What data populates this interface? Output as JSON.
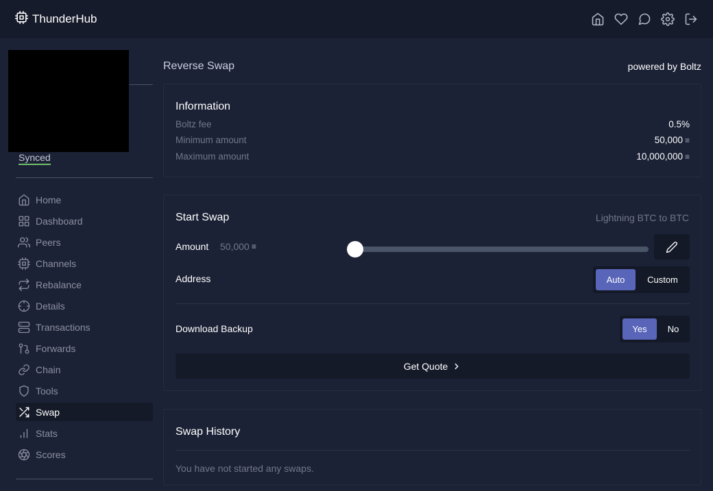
{
  "app": {
    "name": "ThunderHub"
  },
  "top_icons": [
    "home-icon",
    "heart-icon",
    "chat-icon",
    "settings-icon",
    "logout-icon"
  ],
  "sidebar": {
    "status": "Synced",
    "items": [
      {
        "label": "Home",
        "icon": "home-icon"
      },
      {
        "label": "Dashboard",
        "icon": "dashboard-icon"
      },
      {
        "label": "Peers",
        "icon": "users-icon"
      },
      {
        "label": "Channels",
        "icon": "cpu-icon"
      },
      {
        "label": "Rebalance",
        "icon": "repeat-icon"
      },
      {
        "label": "Details",
        "icon": "crosshair-icon"
      },
      {
        "label": "Transactions",
        "icon": "server-icon"
      },
      {
        "label": "Forwards",
        "icon": "git-pull-request-icon"
      },
      {
        "label": "Chain",
        "icon": "link-icon"
      },
      {
        "label": "Tools",
        "icon": "shield-icon"
      },
      {
        "label": "Swap",
        "icon": "shuffle-icon",
        "active": true
      },
      {
        "label": "Stats",
        "icon": "bar-chart-icon"
      },
      {
        "label": "Scores",
        "icon": "aperture-icon"
      }
    ]
  },
  "page": {
    "title": "Reverse Swap",
    "powered_by": "powered by Boltz"
  },
  "info": {
    "title": "Information",
    "rows": [
      {
        "label": "Boltz fee",
        "value": "0.5%",
        "unit": ""
      },
      {
        "label": "Minimum amount",
        "value": "50,000",
        "unit": "sats"
      },
      {
        "label": "Maximum amount",
        "value": "10,000,000",
        "unit": "sats"
      }
    ]
  },
  "start_swap": {
    "title": "Start Swap",
    "subtitle": "Lightning BTC to BTC",
    "amount_label": "Amount",
    "amount_value": "50,000",
    "slider_fraction": 0.0,
    "address_label": "Address",
    "address_options": {
      "auto": "Auto",
      "custom": "Custom",
      "selected": "Auto"
    },
    "backup_label": "Download Backup",
    "backup_options": {
      "yes": "Yes",
      "no": "No",
      "selected": "Yes"
    },
    "quote_button": "Get Quote"
  },
  "history": {
    "title": "Swap History",
    "empty": "You have not started any swaps."
  },
  "colors": {
    "background": "#1c2236",
    "topbar": "#161b2b",
    "accent": "#5865b9",
    "synced": "#72c26a"
  }
}
